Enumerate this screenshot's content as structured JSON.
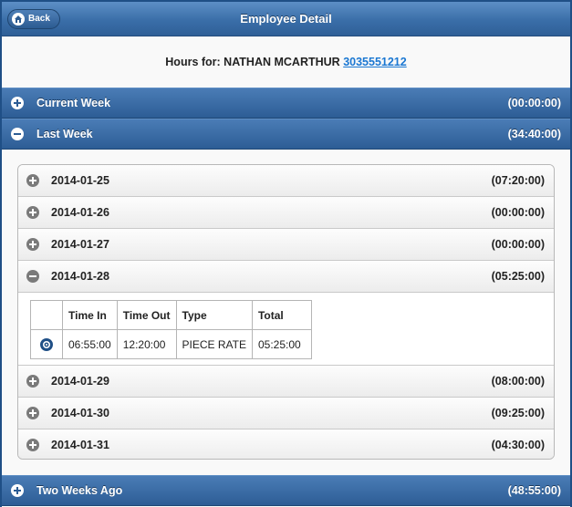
{
  "header": {
    "title": "Employee Detail",
    "back_label": "Back"
  },
  "hours": {
    "prefix": "Hours for: NATHAN MCARTHUR",
    "phone": "3035551212"
  },
  "weeks": [
    {
      "label": "Current Week",
      "total": "(00:00:00)",
      "expanded": false
    },
    {
      "label": "Last Week",
      "total": "(34:40:00)",
      "expanded": true
    },
    {
      "label": "Two Weeks Ago",
      "total": "(48:55:00)",
      "expanded": false
    }
  ],
  "days": [
    {
      "date": "2014-01-25",
      "total": "(07:20:00)",
      "expanded": false
    },
    {
      "date": "2014-01-26",
      "total": "(00:00:00)",
      "expanded": false
    },
    {
      "date": "2014-01-27",
      "total": "(00:00:00)",
      "expanded": false
    },
    {
      "date": "2014-01-28",
      "total": "(05:25:00)",
      "expanded": true
    },
    {
      "date": "2014-01-29",
      "total": "(08:00:00)",
      "expanded": false
    },
    {
      "date": "2014-01-30",
      "total": "(09:25:00)",
      "expanded": false
    },
    {
      "date": "2014-01-31",
      "total": "(04:30:00)",
      "expanded": false
    }
  ],
  "entries_table": {
    "headers": [
      "Time In",
      "Time Out",
      "Type",
      "Total"
    ],
    "rows": [
      {
        "time_in": "06:55:00",
        "time_out": "12:20:00",
        "type": "PIECE RATE",
        "total": "05:25:00"
      }
    ]
  },
  "icons": {
    "back": "home-icon",
    "expand": "plus-icon",
    "collapse": "minus-icon",
    "edit": "gear-icon"
  },
  "colors": {
    "accent": "#2f5f97",
    "link": "#1a77d2"
  }
}
